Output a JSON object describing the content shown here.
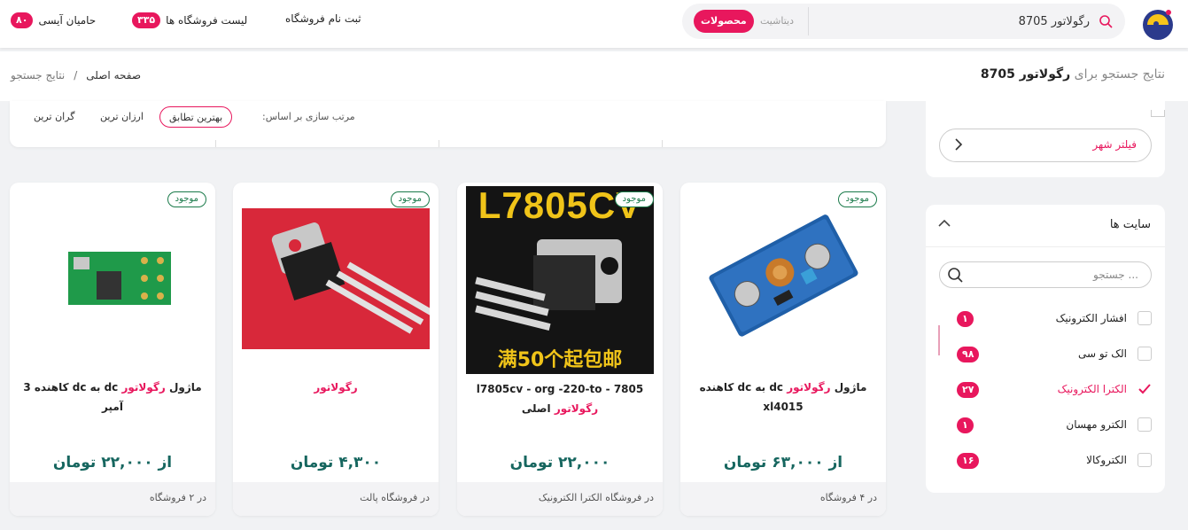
{
  "header": {
    "search_query": "رگولاتور 8705",
    "scope_products": "محصولات",
    "scope_datasheet": "دیتاشیت",
    "nav": [
      {
        "label": "ثبت نام فروشگاه"
      },
      {
        "label": "لیست فروشگاه ها",
        "count": "۳۳۵"
      },
      {
        "label": "حامیان آیسی",
        "count": "۸۰"
      }
    ]
  },
  "breadcrumb": {
    "results_prefix": "نتایج جستجو برای",
    "results_query": "رگولاتور 8705",
    "home": "صفحه اصلی",
    "separator": "/",
    "current": "نتایج جستجو"
  },
  "sort": {
    "label": "مرتب سازی بر اساس:",
    "options": [
      "بهترین تطابق",
      "ارزان ترین",
      "گران ترین"
    ],
    "active": "بهترین تطابق"
  },
  "city_filter": {
    "label": "فیلتر شهر"
  },
  "sites": {
    "title": "سایت ها",
    "search_placeholder": "جستجو ...",
    "items": [
      {
        "name": "افشار الکترونیک",
        "count": "۱",
        "checked": false
      },
      {
        "name": "الک تو سی",
        "count": "۹۸",
        "checked": false
      },
      {
        "name": "الکترا الکترونیک",
        "count": "۲۷",
        "checked": true
      },
      {
        "name": "الکترو مهسان",
        "count": "۱",
        "checked": false
      },
      {
        "name": "الکتروکالا",
        "count": "۱۶",
        "checked": false
      }
    ]
  },
  "products": [
    {
      "stock": "موجود",
      "title_pre": "ماژول ",
      "title_hl": "رگولاتور",
      "title_post": " dc به dc کاهنده xl4015",
      "price": "از ۶۳,۰۰۰ تومان",
      "shop": "در ۴ فروشگاه"
    },
    {
      "stock": "موجود",
      "title_pre": "7805 - l7805cv - org -220-to ",
      "title_hl": "رگولاتور",
      "title_post": " اصلی",
      "price": "۲۲,۰۰۰ تومان",
      "shop": "در فروشگاه الکترا الکترونیک",
      "image_caption": "L7805CV",
      "image_caption2": "满50个起包邮"
    },
    {
      "stock": "موجود",
      "title_pre": "",
      "title_hl": "رگولاتور",
      "title_post": "",
      "price": "۴,۳۰۰ تومان",
      "shop": "در فروشگاه پالت"
    },
    {
      "stock": "موجود",
      "title_pre": "ماژول ",
      "title_hl": "رگولاتور",
      "title_post": " dc به dc کاهنده 3 آمپر",
      "price": "از ۲۲,۰۰۰ تومان",
      "shop": "در ۲ فروشگاه"
    }
  ],
  "colors": {
    "accent": "#e8175d",
    "price": "#16665f",
    "stock": "#1a7a4a"
  }
}
